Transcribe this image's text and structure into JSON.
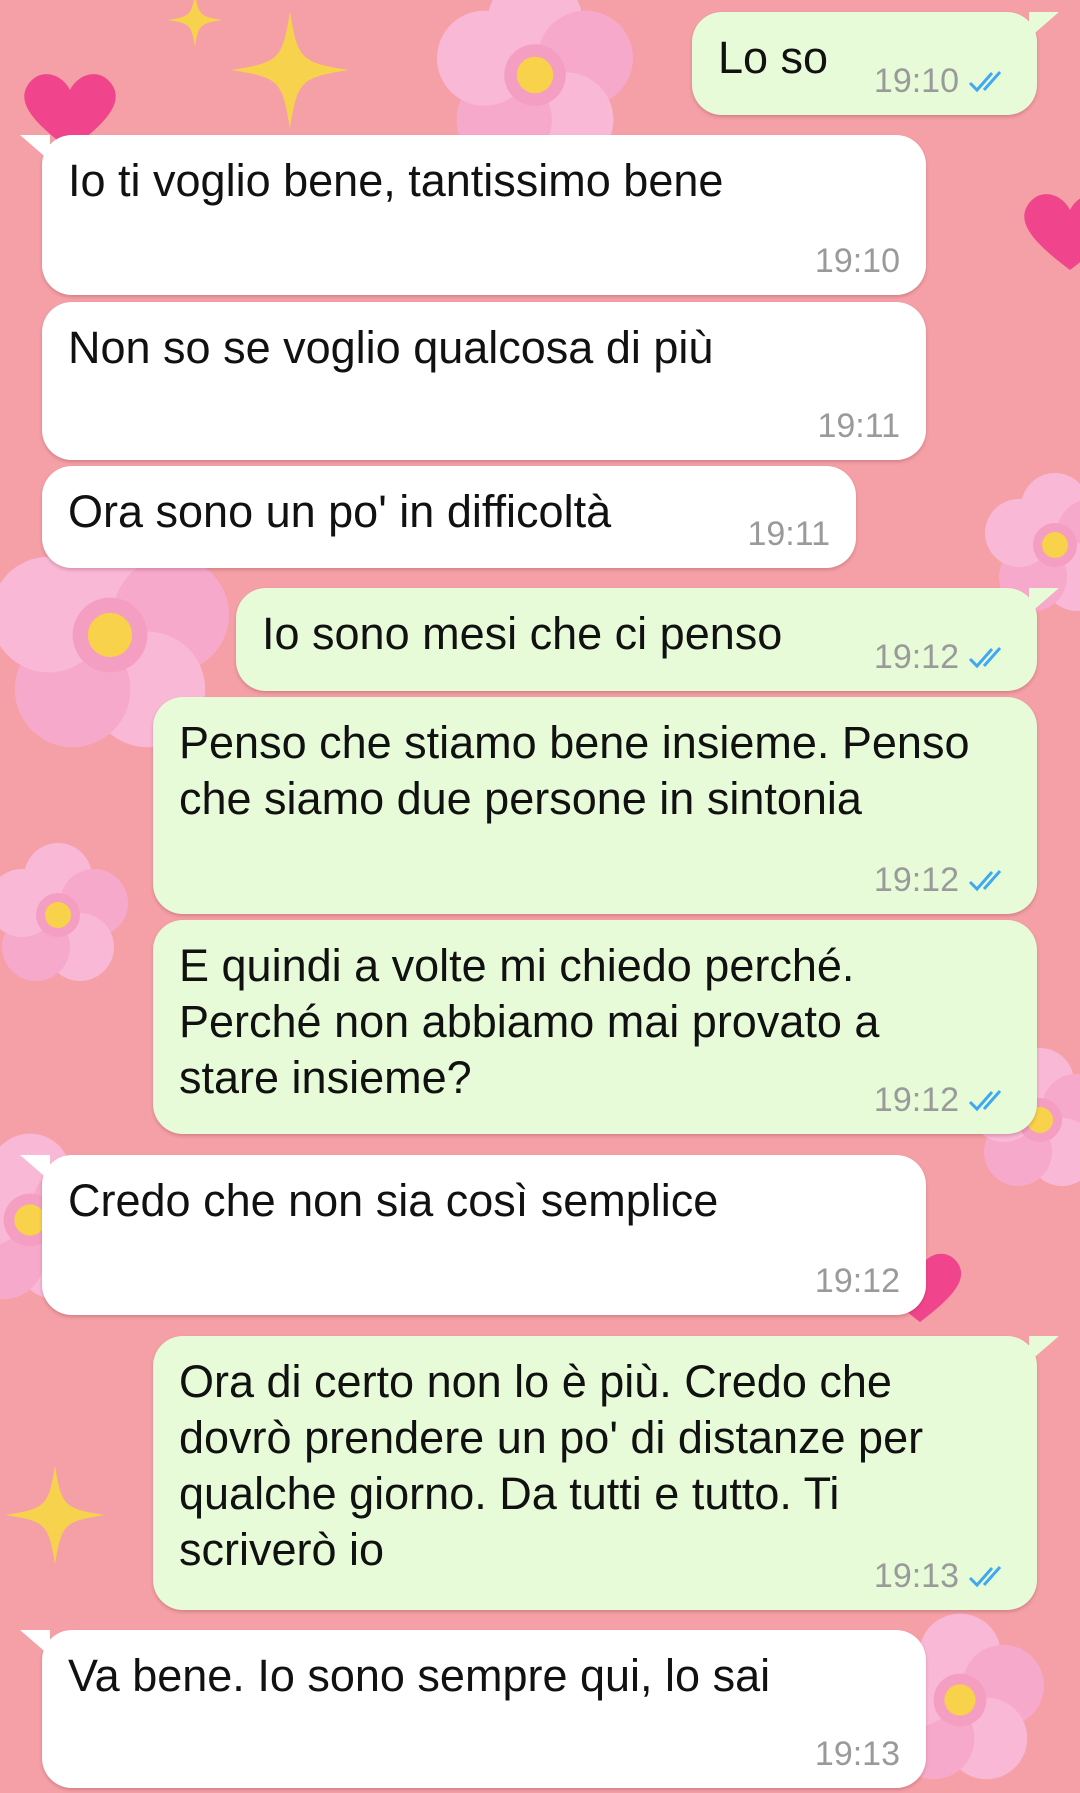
{
  "colors": {
    "wallpaper": "#f4a0a6",
    "incoming_bubble": "#ffffff",
    "outgoing_bubble": "#e7fbd9",
    "timestamp": "#9a9a9a",
    "read_check": "#3fa9ef"
  },
  "wallpaper_icons": [
    "cherry-blossom-icon",
    "sparkle-icon",
    "heart-icon"
  ],
  "messages": [
    {
      "direction": "outgoing",
      "text": "Lo so",
      "time": "19:10",
      "status": "read-check-icon"
    },
    {
      "direction": "incoming",
      "text": "Io ti voglio bene, tantissimo bene",
      "time": "19:10"
    },
    {
      "direction": "incoming",
      "text": "Non so se voglio qualcosa di più",
      "time": "19:11"
    },
    {
      "direction": "incoming",
      "text": "Ora sono un po' in difficoltà",
      "time": "19:11"
    },
    {
      "direction": "outgoing",
      "text": "Io sono mesi che ci penso",
      "time": "19:12",
      "status": "read-check-icon"
    },
    {
      "direction": "outgoing",
      "text": "Penso che stiamo bene insieme. Penso\nche siamo due persone in sintonia",
      "time": "19:12",
      "status": "read-check-icon"
    },
    {
      "direction": "outgoing",
      "text": "E quindi a volte mi chiedo perché.\nPerché non abbiamo mai provato a\nstare insieme?",
      "time": "19:12",
      "status": "read-check-icon"
    },
    {
      "direction": "incoming",
      "text": "Credo che non sia così semplice",
      "time": "19:12"
    },
    {
      "direction": "outgoing",
      "text": "Ora di certo non lo è più. Credo che\ndovrò prendere un po' di distanze per\nqualche giorno. Da tutti e tutto. Ti\nscriverò io",
      "time": "19:13",
      "status": "read-check-icon"
    },
    {
      "direction": "incoming",
      "text": "Va bene. Io sono sempre qui, lo sai",
      "time": "19:13"
    }
  ]
}
